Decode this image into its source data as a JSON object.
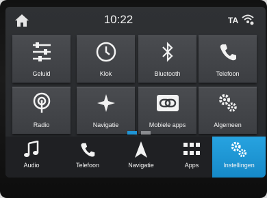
{
  "status": {
    "time": "10:22",
    "ta": "TA"
  },
  "tiles": [
    {
      "label": "Geluid",
      "icon": "sliders-icon"
    },
    {
      "label": "Klok",
      "icon": "clock-icon"
    },
    {
      "label": "Bluetooth",
      "icon": "bluetooth-icon"
    },
    {
      "label": "Telefoon",
      "icon": "phone-icon"
    },
    {
      "label": "Radio",
      "icon": "radio-icon"
    },
    {
      "label": "Navigatie",
      "icon": "navigation-star-icon"
    },
    {
      "label": "Mobiele apps",
      "icon": "link-icon"
    },
    {
      "label": "Algemeen",
      "icon": "gears-icon"
    }
  ],
  "pagination": {
    "pages": 2,
    "current": 1
  },
  "nav": [
    {
      "label": "Audio",
      "icon": "music-note-icon",
      "active": false
    },
    {
      "label": "Telefoon",
      "icon": "phone-icon",
      "active": false
    },
    {
      "label": "Navigatie",
      "icon": "navigation-arrow-icon",
      "active": false
    },
    {
      "label": "Apps",
      "icon": "apps-grid-icon",
      "active": false
    },
    {
      "label": "Instellingen",
      "icon": "gears-icon",
      "active": true
    }
  ],
  "colors": {
    "accent": "#1f95d6",
    "text": "#f4f4f4"
  }
}
